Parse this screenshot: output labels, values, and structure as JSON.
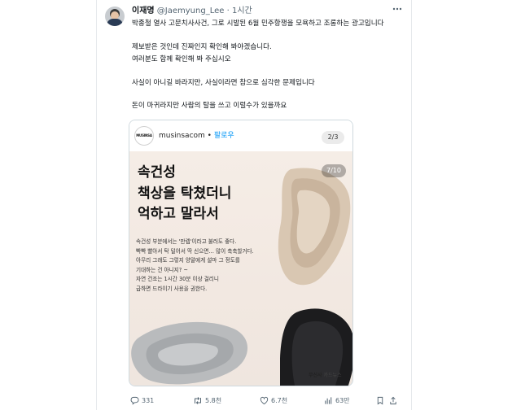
{
  "post": {
    "author_name": "이재명",
    "handle": "@Jaemyung_Lee",
    "separator": "·",
    "time": "1시간",
    "more_icon": "more-horizontal-icon",
    "body_lines": [
      "박종철 열사 고문치사사건, 그로 시발된 6월 민주항쟁을 모욕하고 조롱하는 광고입니다",
      "제보받은 것인데 진짜인지 확인해 봐야겠습니다.",
      "여러분도 함께 확인해 봐 주십시오",
      "사실이 아니길 바라지만, 사실이라면 참으로 심각한 문제입니다",
      "돈이 마귀라지만 사람의 탈을 쓰고 이럴수가 있을까요"
    ]
  },
  "embedded": {
    "logo_text": "MUSINSA",
    "account": "musinsacom",
    "dot": " • ",
    "follow": "팔로우",
    "page_badge": "2/3",
    "slide_counter": "7/10",
    "headline_lines": [
      "속건성",
      "책상을 탁쳤더니",
      "억하고 말라서"
    ],
    "text_lines": [
      "속건성 부분에서는 '만렙'이라고 불러도 좋다.",
      "빡빡 빨아서 탁 털어서 딱 신으면… 많이 축축할거다.",
      "아무리 그래도 그렇지 양말에게 설마 그 정도를",
      "기대하는 건 아니지? ~",
      "자연 건조는 1시간 30분 이상 걸리니",
      "급하면 드라이기 사용을 권한다."
    ],
    "caption_brand": "무신사",
    "caption_rest": " 카드뉴스"
  },
  "actions": {
    "replies": "331",
    "reposts": "5.8천",
    "likes": "6.7천",
    "views": "63만",
    "icons": [
      "reply-icon",
      "repost-icon",
      "like-icon",
      "views-icon",
      "bookmark-icon",
      "share-icon"
    ]
  },
  "colors": {
    "text": "#0f1419",
    "muted": "#536471",
    "follow": "#0095f6",
    "slide_bg": "#f3ebe4"
  }
}
